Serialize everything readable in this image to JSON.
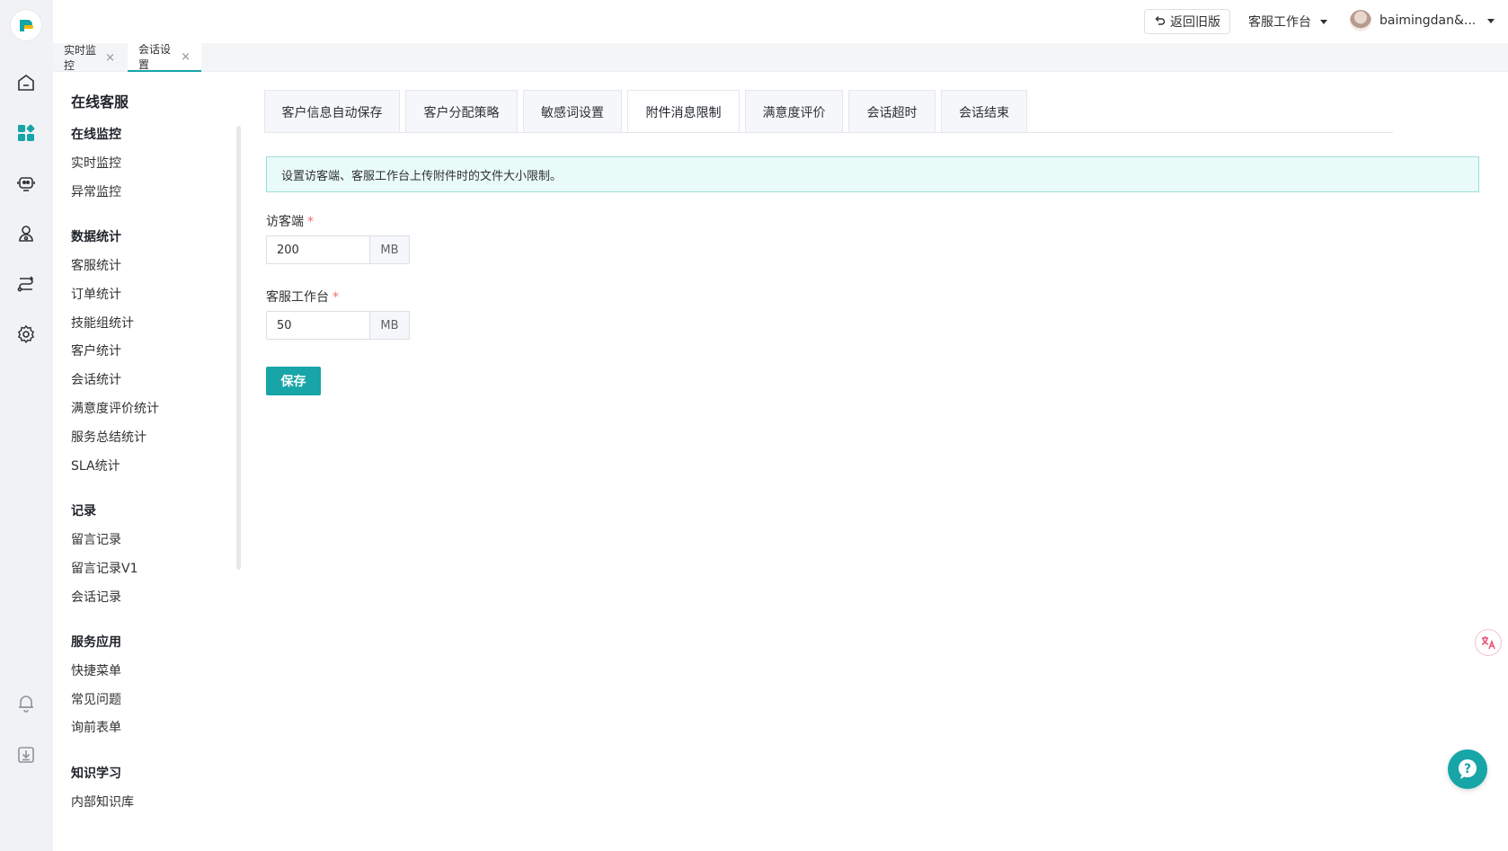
{
  "colors": {
    "accent": "#17a5a8",
    "required": "#f56c6c",
    "notice_bg": "#e9fbf9"
  },
  "rail": {
    "icons": [
      "app-logo-icon",
      "home-icon",
      "dashboard-grid-icon",
      "robot-icon",
      "user-group-icon",
      "route-icon",
      "settings-gear-icon",
      "bell-icon",
      "download-box-icon"
    ]
  },
  "topbar": {
    "old_version": "返回旧版",
    "workbench": "客服工作台",
    "username": "baimingdan&..."
  },
  "page_tabs": [
    {
      "label": "实时监控"
    },
    {
      "label": "会话设置"
    }
  ],
  "sidebar": {
    "title": "在线客服",
    "groups": [
      {
        "label": "在线监控",
        "items": [
          "实时监控",
          "异常监控"
        ]
      },
      {
        "label": "数据统计",
        "items": [
          "客服统计",
          "订单统计",
          "技能组统计",
          "客户统计",
          "会话统计",
          "满意度评价统计",
          "服务总结统计",
          "SLA统计"
        ]
      },
      {
        "label": "记录",
        "items": [
          "留言记录",
          "留言记录V1",
          "会话记录"
        ]
      },
      {
        "label": "服务应用",
        "items": [
          "快捷菜单",
          "常见问题",
          "询前表单"
        ]
      },
      {
        "label": "知识学习",
        "items": [
          "内部知识库"
        ]
      }
    ]
  },
  "settings_tabs": [
    "客户信息自动保存",
    "客户分配策略",
    "敏感词设置",
    "附件消息限制",
    "满意度评价",
    "会话超时",
    "会话结束"
  ],
  "notice": "设置访客端、客服工作台上传附件时的文件大小限制。",
  "form": {
    "visitor_label": "访客端",
    "visitor_value": "200",
    "agent_label": "客服工作台",
    "agent_value": "50",
    "unit": "MB",
    "required_mark": "*",
    "save_label": "保存"
  },
  "floating": {
    "translate_icon": "translate-icon",
    "help_icon": "help-question-icon"
  }
}
